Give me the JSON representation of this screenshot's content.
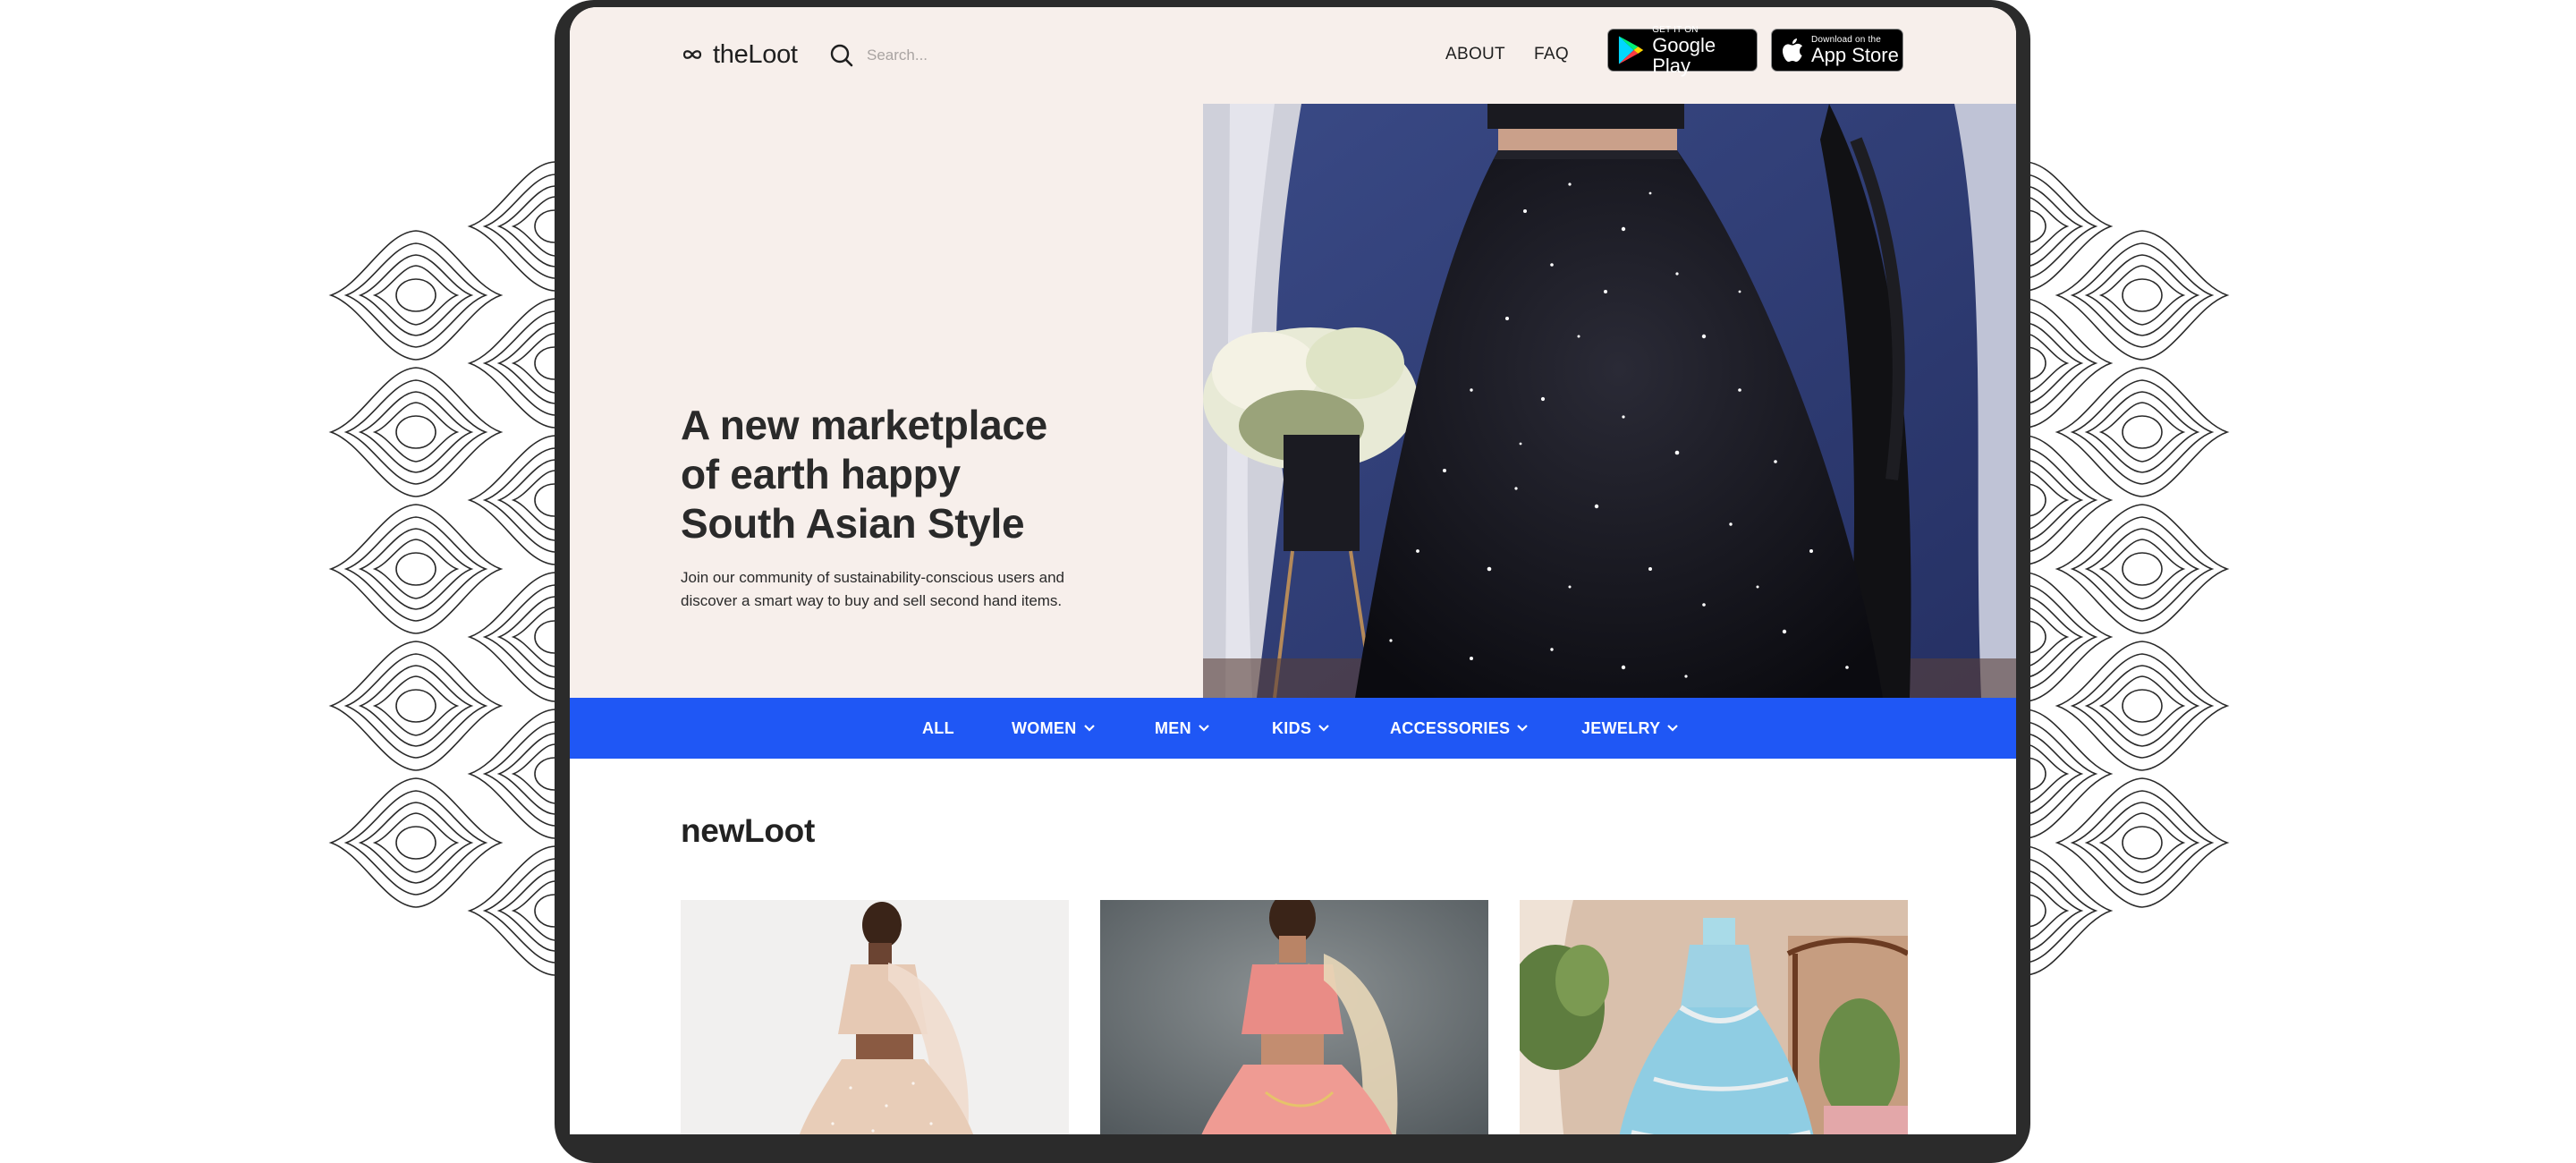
{
  "brand": {
    "name": "theLoot"
  },
  "search": {
    "placeholder": "Search..."
  },
  "nav": {
    "about": "ABOUT",
    "faq": "FAQ"
  },
  "stores": {
    "google": {
      "small": "GET IT ON",
      "big": "Google Play"
    },
    "apple": {
      "small": "Download on the",
      "big": "App Store"
    }
  },
  "hero": {
    "title_lines": [
      "A new marketplace",
      "of earth happy",
      "South Asian Style"
    ],
    "subtitle": "Join our community of sustainability-conscious users and discover a smart way to buy and sell second hand items."
  },
  "categories": [
    {
      "label": "ALL",
      "dropdown": false
    },
    {
      "label": "WOMEN",
      "dropdown": true
    },
    {
      "label": "MEN",
      "dropdown": true
    },
    {
      "label": "KIDS",
      "dropdown": true
    },
    {
      "label": "ACCESSORIES",
      "dropdown": true
    },
    {
      "label": "JEWELRY",
      "dropdown": true
    }
  ],
  "section": {
    "title": "newLoot"
  },
  "colors": {
    "accent": "#1f57f5",
    "hero_bg": "#f7efeb",
    "frame": "#2b2b2b"
  },
  "icons": {
    "logo": "infinity-logo-icon",
    "search": "search-icon",
    "google": "google-play-icon",
    "apple": "apple-icon",
    "dropdown": "chevron-down-icon"
  }
}
